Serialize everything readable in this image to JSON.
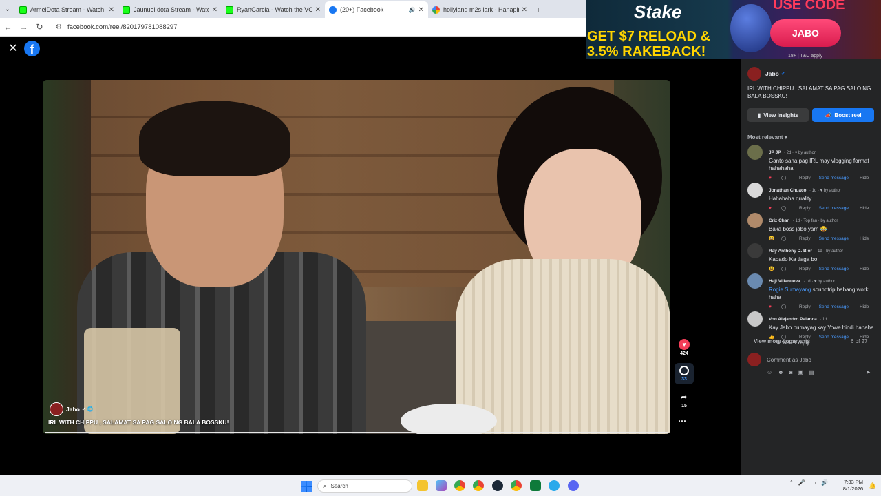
{
  "browser": {
    "tabs": [
      {
        "title": "ArmelDota Stream - Watch Liv",
        "icon": "kick",
        "active": false
      },
      {
        "title": "Jaunuel dota Stream - Watch Liv",
        "icon": "kick",
        "active": false
      },
      {
        "title": "RyanGarcia - Watch the VOD o",
        "icon": "kick",
        "active": false
      },
      {
        "title": "(20+) Facebook",
        "icon": "facebook",
        "active": true
      },
      {
        "title": "hollyland m2s lark - Hanapin sa",
        "icon": "google",
        "active": false
      }
    ],
    "url": "facebook.com/reel/820179781088297"
  },
  "ad": {
    "brand": "Stake",
    "promo_line1": "GET $7 RELOAD &",
    "promo_line2": "3.5% RAKEBACK!",
    "use_code": "USE CODE",
    "code": "JABO",
    "terms": "18+ | T&C apply"
  },
  "reel": {
    "author": "Jabo",
    "caption": "IRL WITH CHIPPU , SALAMAT SA PAG SALO NG BALA BOSSKU!",
    "likes": "424",
    "comments": "33",
    "shares": "15"
  },
  "panel": {
    "author": "Jabo",
    "caption": "IRL WITH CHIPPU , SALAMAT SA PAG SALO NG BALA BOSSKU!",
    "insights_label": "View Insights",
    "boost_label": "Boost reel",
    "sort_label": "Most relevant",
    "comments": [
      {
        "name": "JP JP",
        "meta": "· 2d · ♥ by author",
        "text": "Ganto sana pag IRL may vlogging format hahahaha",
        "avatar_color": "#6b6e4a"
      },
      {
        "name": "Jonathan Chuaco",
        "meta": "· 1d · ♥ by author",
        "text": "Hahahaha quality",
        "avatar_color": "#d9d9d9"
      },
      {
        "name": "Criz Chan",
        "meta": "· 1d · Top fan · by author",
        "text": "Baka boss jabo yarn 😂",
        "avatar_color": "#b08a6a"
      },
      {
        "name": "Ray Anthony D. Blor",
        "meta": "· 1d · by author",
        "text": "Kabado Ka tlaga bo",
        "avatar_color": "#3a3a3a"
      },
      {
        "name": "Haji Villanueva",
        "meta": "· 1d · ♥ by author",
        "tag": "Rogie Sumayang",
        "text": " soundtrip habang work haha",
        "avatar_color": "#6a8ab0"
      },
      {
        "name": "Von Alejandro Palanca",
        "meta": "· 1d",
        "text": "Kay Jabo pumayag kay Yowe hindi hahaha",
        "avatar_color": "#c8c8c8"
      }
    ],
    "reply_label": "Reply",
    "send_label": "Send message",
    "hide_label": "Hide",
    "view_reply": "View 1 reply",
    "view_more": "View more comments",
    "count": "6 of 27",
    "compose_placeholder": "Comment as Jabo"
  },
  "taskbar": {
    "search_placeholder": "Search",
    "time": "7:33 PM",
    "date": "8/1/2026"
  }
}
